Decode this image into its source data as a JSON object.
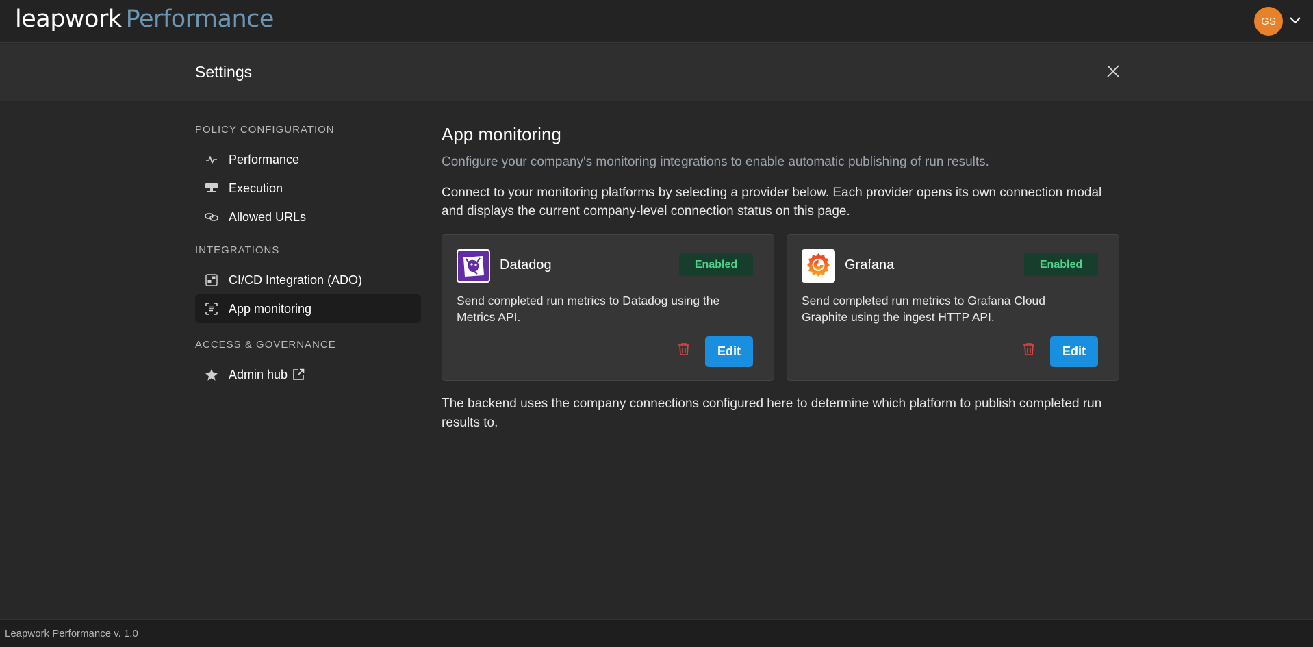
{
  "app": {
    "brand": "leapwork",
    "product": "Performance",
    "user_initials": "GS",
    "version": "Leapwork Performance v. 1.0"
  },
  "settings": {
    "title": "Settings"
  },
  "sidebar": {
    "sections": [
      {
        "title": "POLICY CONFIGURATION",
        "items": [
          {
            "label": "Performance",
            "icon": "pulse-icon"
          },
          {
            "label": "Execution",
            "icon": "server-icon"
          },
          {
            "label": "Allowed URLs",
            "icon": "link-icon"
          }
        ]
      },
      {
        "title": "INTEGRATIONS",
        "items": [
          {
            "label": "CI/CD Integration (ADO)",
            "icon": "widgets-icon"
          },
          {
            "label": "App monitoring",
            "icon": "scan-icon",
            "active": true
          }
        ]
      },
      {
        "title": "ACCESS & GOVERNANCE",
        "items": [
          {
            "label": "Admin hub",
            "icon": "star-icon",
            "external": true
          }
        ]
      }
    ]
  },
  "main": {
    "title": "App monitoring",
    "subtitle": "Configure your company's monitoring integrations to enable automatic publishing of run results.",
    "description": "Connect to your monitoring platforms by selecting a provider below. Each provider opens its own connection modal and displays the current company-level connection status on this page.",
    "providers": [
      {
        "name": "Datadog",
        "status": "Enabled",
        "description": "Send completed run metrics to Datadog using the Metrics API.",
        "edit_label": "Edit",
        "logo": "datadog-logo-icon"
      },
      {
        "name": "Grafana",
        "status": "Enabled",
        "description": "Send completed run metrics to Grafana Cloud Graphite using the ingest HTTP API.",
        "edit_label": "Edit",
        "logo": "grafana-logo-icon"
      }
    ],
    "footer_note": "The backend uses the company connections configured here to determine which platform to publish completed run results to."
  },
  "colors": {
    "accent": "#1a8fe0",
    "status_enabled_bg": "#173d2c",
    "status_enabled_text": "#4fd18a",
    "delete": "#e04545",
    "avatar": "#e8822a"
  }
}
